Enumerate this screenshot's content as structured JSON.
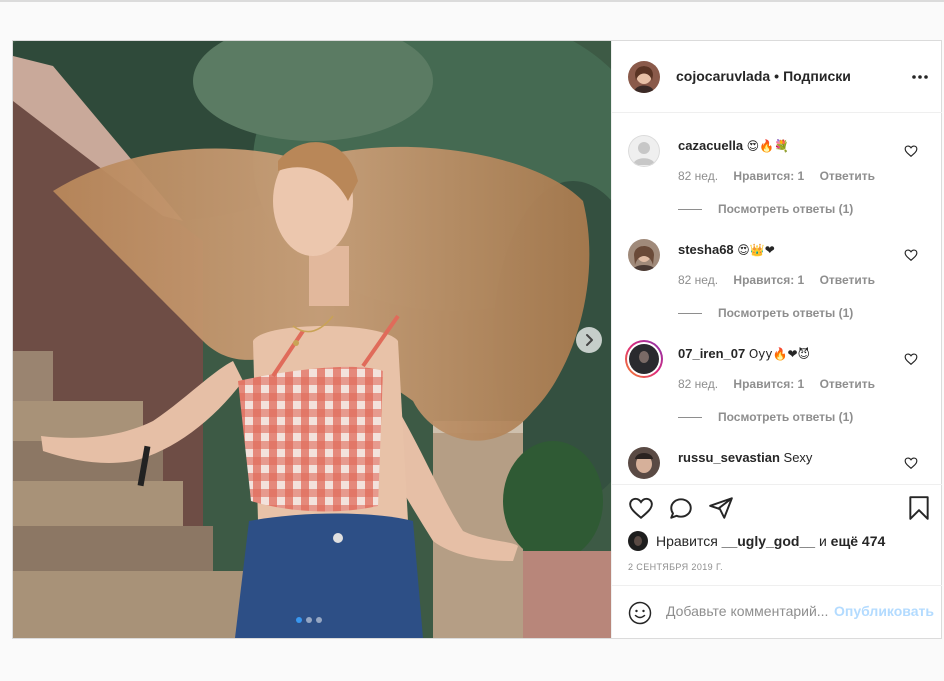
{
  "post": {
    "author": "cojocaruvlada",
    "separator": "•",
    "follow_label": "Подписки",
    "comments": [
      {
        "user": "cazacuella",
        "text": "😍🔥💐",
        "age": "82 нед.",
        "likes": "Нравится: 1",
        "reply_label": "Ответить",
        "view_replies": "Посмотреть ответы (1)"
      },
      {
        "user": "stesha68",
        "text": "😍👑❤",
        "age": "82 нед.",
        "likes": "Нравится: 1",
        "reply_label": "Ответить",
        "view_replies": "Посмотреть ответы (1)"
      },
      {
        "user": "07_iren_07",
        "text": "Oyy🔥❤😈",
        "age": "82 нед.",
        "likes": "Нравится: 1",
        "reply_label": "Ответить",
        "view_replies": "Посмотреть ответы (1)"
      },
      {
        "user": "russu_sevastian",
        "text": "Sexy"
      }
    ],
    "likes": {
      "prefix": "Нравится",
      "liker": "__ugly_god__",
      "conj": "и",
      "others": "ещё 474"
    },
    "date": "2 сентября 2019 г.",
    "comment_placeholder": "Добавьте комментарий...",
    "publish_label": "Опубликовать",
    "carousel": {
      "slides": 3,
      "active": 1
    }
  },
  "colors": {
    "accent": "#3897f0",
    "publish_disabled": "#b3dbff",
    "muted": "#8e8e8e",
    "border": "#dbdbdb"
  },
  "icons": [
    "more-icon",
    "heart-icon",
    "comment-icon",
    "share-icon",
    "bookmark-icon",
    "emoji-icon",
    "chevron-right-icon"
  ]
}
